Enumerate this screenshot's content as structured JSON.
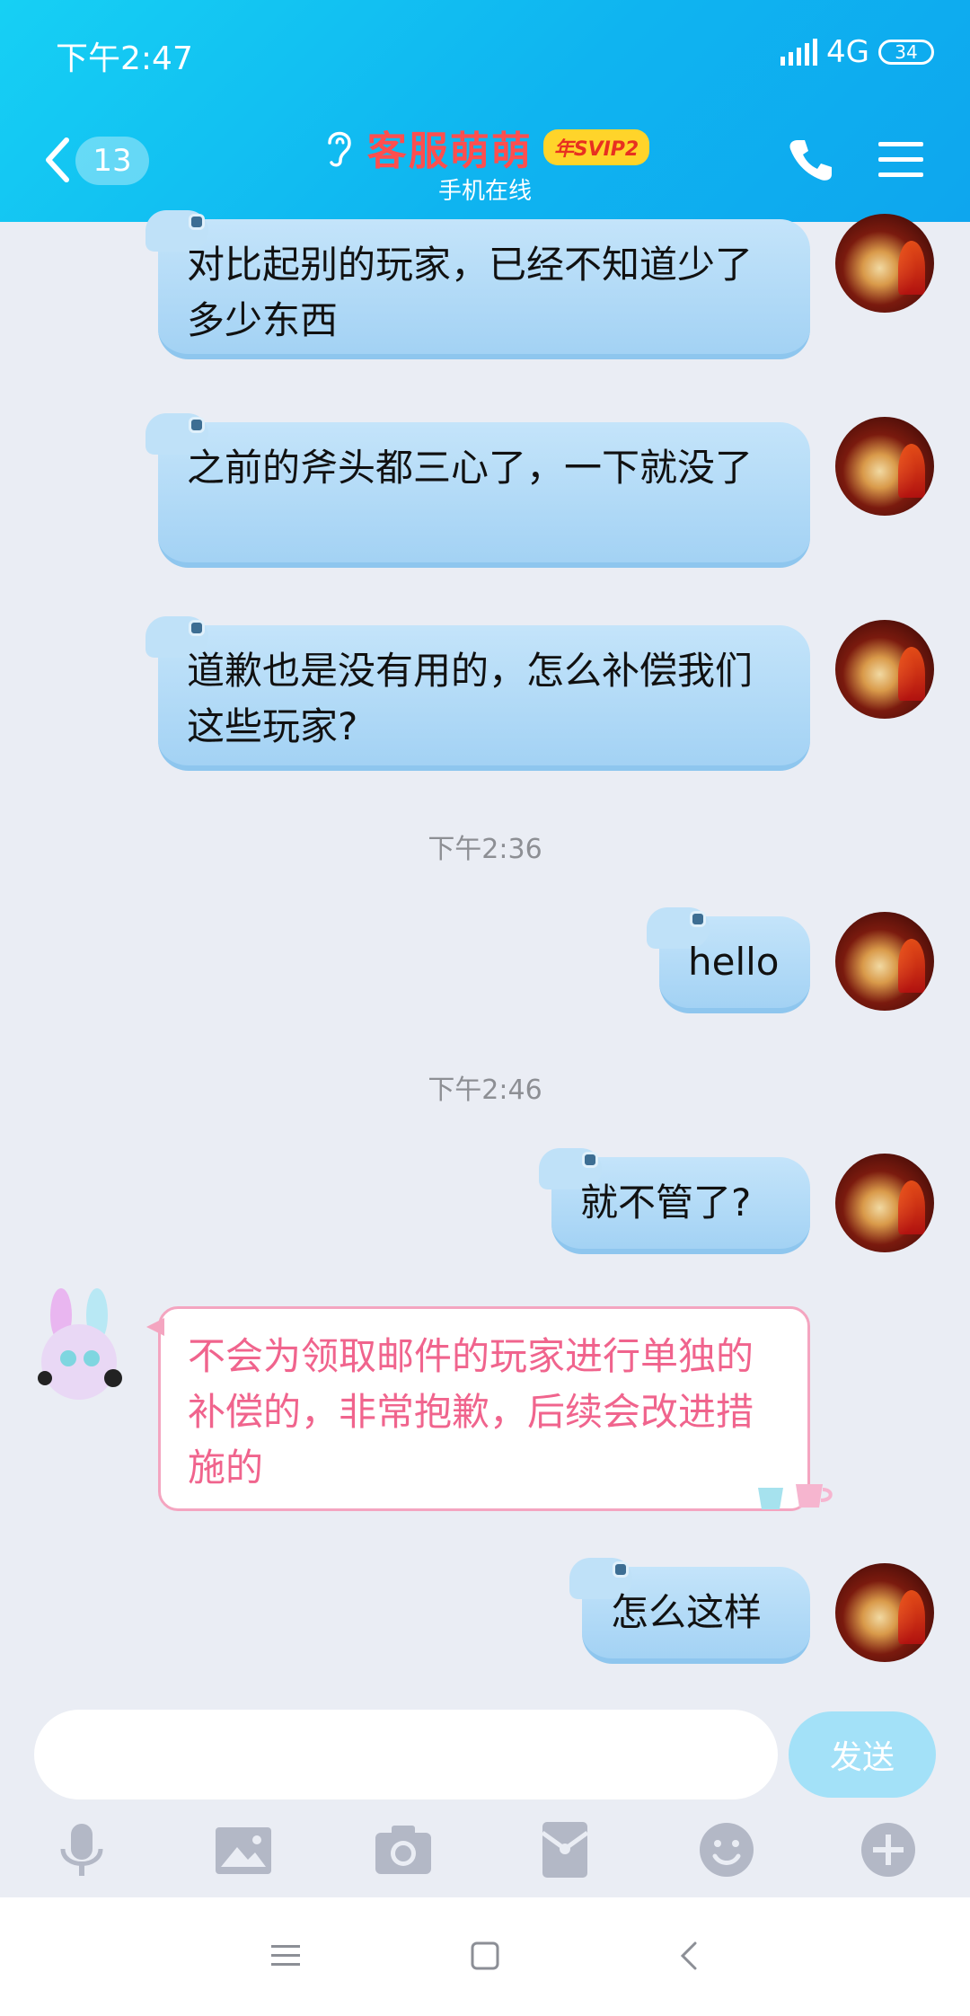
{
  "status_bar": {
    "time": "下午2:47",
    "network": "4G",
    "battery": "34"
  },
  "header": {
    "unread_count": "13",
    "contact_name": "客服萌萌",
    "vip_badge": "年SVIP2",
    "contact_status": "手机在线"
  },
  "messages": [
    {
      "sender": "self",
      "text": "对比起别的玩家，已经不知道少了多少东西"
    },
    {
      "sender": "self",
      "text": "之前的斧头都三心了，一下就没了"
    },
    {
      "sender": "self",
      "text": "道歉也是没有用的，怎么补偿我们这些玩家?"
    },
    {
      "type": "timestamp",
      "text": "下午2:36"
    },
    {
      "sender": "self",
      "text": "hello"
    },
    {
      "type": "timestamp",
      "text": "下午2:46"
    },
    {
      "sender": "self",
      "text": "就不管了?"
    },
    {
      "sender": "customer_service",
      "text": "不会为领取邮件的玩家进行单独的补偿的，非常抱歉，后续会改进措施的"
    },
    {
      "sender": "self",
      "text": "怎么这样"
    }
  ],
  "input": {
    "placeholder": "",
    "send_label": "发送"
  },
  "toolbar": [
    "microphone-icon",
    "image-icon",
    "camera-icon",
    "red-packet-icon",
    "emoji-icon",
    "plus-icon"
  ],
  "colors": {
    "header": "#12bdf2",
    "outgoing_bubble": "#aed8f5",
    "incoming_text": "#f0648d",
    "name": "#ff4e4e"
  }
}
